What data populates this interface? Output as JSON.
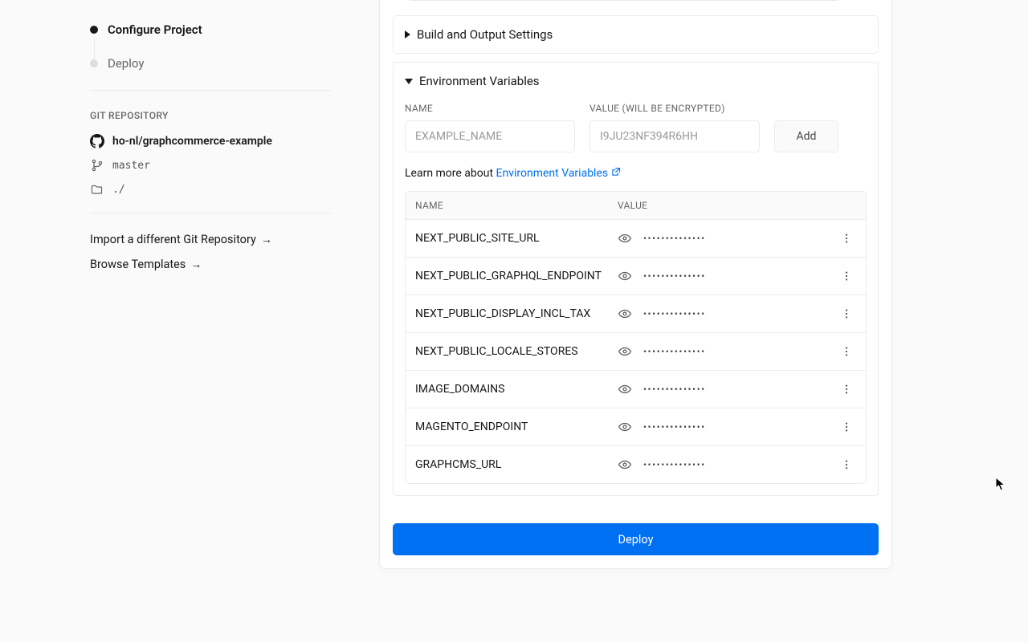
{
  "sidebar": {
    "steps": [
      {
        "label": "Configure Project",
        "active": true
      },
      {
        "label": "Deploy",
        "active": false
      }
    ],
    "git_section_label": "GIT REPOSITORY",
    "repo_name": "ho-nl/graphcommerce-example",
    "branch": "master",
    "root_dir": "./",
    "import_link": "Import a different Git Repository",
    "browse_link": "Browse Templates"
  },
  "card": {
    "build_section_title": "Build and Output Settings",
    "env_section_title": "Environment Variables",
    "name_label": "NAME",
    "value_label": "VALUE (WILL BE ENCRYPTED)",
    "name_placeholder": "EXAMPLE_NAME",
    "value_placeholder": "I9JU23NF394R6HH",
    "add_label": "Add",
    "learn_more_prefix": "Learn more about ",
    "learn_more_link": "Environment Variables",
    "table_header_name": "NAME",
    "table_header_value": "VALUE",
    "masked_value": "••••••••••••••",
    "env_vars": [
      {
        "name": "NEXT_PUBLIC_SITE_URL"
      },
      {
        "name": "NEXT_PUBLIC_GRAPHQL_ENDPOINT"
      },
      {
        "name": "NEXT_PUBLIC_DISPLAY_INCL_TAX"
      },
      {
        "name": "NEXT_PUBLIC_LOCALE_STORES"
      },
      {
        "name": "IMAGE_DOMAINS"
      },
      {
        "name": "MAGENTO_ENDPOINT"
      },
      {
        "name": "GRAPHCMS_URL"
      }
    ],
    "deploy_label": "Deploy"
  }
}
